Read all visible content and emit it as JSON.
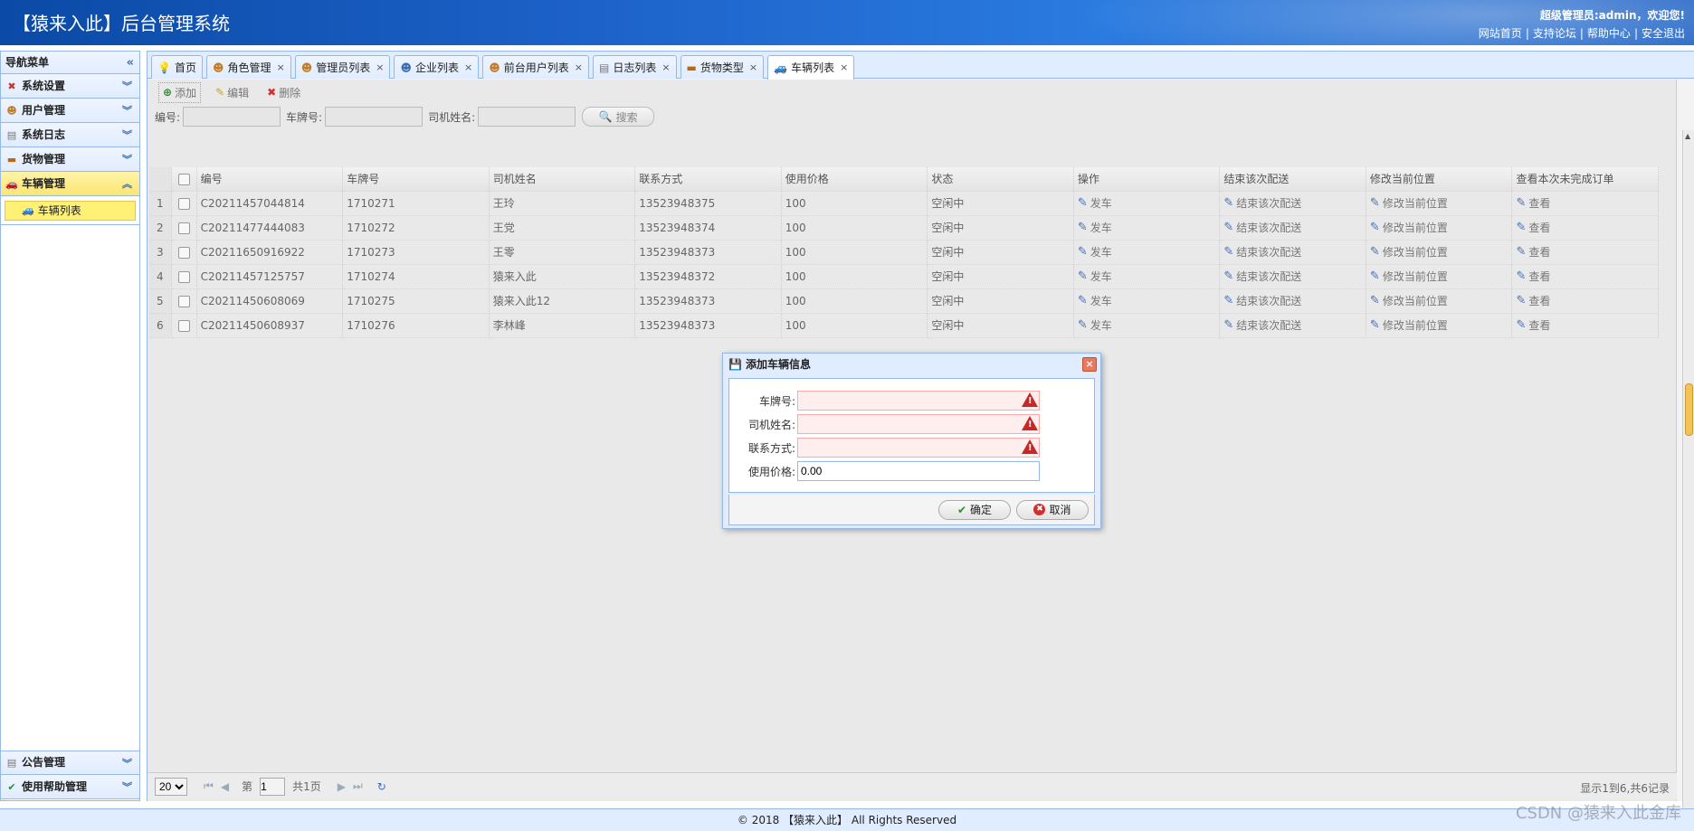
{
  "header": {
    "title": "【猿来入此】后台管理系统",
    "welcome": "超级管理员:admin，欢迎您!",
    "links": [
      "网站首页",
      "支持论坛",
      "帮助中心",
      "安全退出"
    ]
  },
  "sidebar": {
    "title": "导航菜单",
    "items": [
      {
        "label": "系统设置",
        "icon": "tools-icon"
      },
      {
        "label": "用户管理",
        "icon": "users-icon"
      },
      {
        "label": "系统日志",
        "icon": "log-icon"
      },
      {
        "label": "货物管理",
        "icon": "box-icon"
      },
      {
        "label": "车辆管理",
        "icon": "car-icon"
      }
    ],
    "sub_item": "车辆列表",
    "bottom_items": [
      {
        "label": "公告管理",
        "icon": "notice-icon"
      },
      {
        "label": "使用帮助管理",
        "icon": "check-icon"
      }
    ]
  },
  "tabs": [
    "首页",
    "角色管理",
    "管理员列表",
    "企业列表",
    "前台用户列表",
    "日志列表",
    "货物类型",
    "车辆列表"
  ],
  "toolbar": {
    "add": "添加",
    "edit": "编辑",
    "delete": "删除"
  },
  "search": {
    "number_label": "编号:",
    "plate_label": "车牌号:",
    "driver_label": "司机姓名:",
    "button": "搜索"
  },
  "grid": {
    "columns": [
      "编号",
      "车牌号",
      "司机姓名",
      "联系方式",
      "使用价格",
      "状态",
      "操作",
      "结束该次配送",
      "修改当前位置",
      "查看本次未完成订单"
    ],
    "rows": [
      {
        "n": "1",
        "id": "C20211457044814",
        "plate": "1710271",
        "driver": "王玲",
        "phone": "13523948375",
        "price": "100",
        "status": "空闲中"
      },
      {
        "n": "2",
        "id": "C20211477444083",
        "plate": "1710272",
        "driver": "王党",
        "phone": "13523948374",
        "price": "100",
        "status": "空闲中"
      },
      {
        "n": "3",
        "id": "C20211650916922",
        "plate": "1710273",
        "driver": "王零",
        "phone": "13523948373",
        "price": "100",
        "status": "空闲中"
      },
      {
        "n": "4",
        "id": "C20211457125757",
        "plate": "1710274",
        "driver": "猿来入此",
        "phone": "13523948372",
        "price": "100",
        "status": "空闲中"
      },
      {
        "n": "5",
        "id": "C20211450608069",
        "plate": "1710275",
        "driver": "猿来入此12",
        "phone": "13523948373",
        "price": "100",
        "status": "空闲中"
      },
      {
        "n": "6",
        "id": "C20211450608937",
        "plate": "1710276",
        "driver": "李林峰",
        "phone": "13523948373",
        "price": "100",
        "status": "空闲中"
      }
    ],
    "actions": {
      "send": "发车",
      "end": "结束该次配送",
      "modify": "修改当前位置",
      "view": "查看"
    }
  },
  "pager": {
    "page_size": "20",
    "page_prefix": "第",
    "page": "1",
    "page_total": "共1页",
    "info": "显示1到6,共6记录"
  },
  "dialog": {
    "title": "添加车辆信息",
    "fields": [
      {
        "label": "车牌号:",
        "value": ""
      },
      {
        "label": "司机姓名:",
        "value": ""
      },
      {
        "label": "联系方式:",
        "value": ""
      },
      {
        "label": "使用价格:",
        "value": "0.00"
      }
    ],
    "ok": "确定",
    "cancel": "取消"
  },
  "footer": "© 2018 【猿来入此】 All Rights Reserved",
  "watermark": "CSDN @猿来入此金库"
}
